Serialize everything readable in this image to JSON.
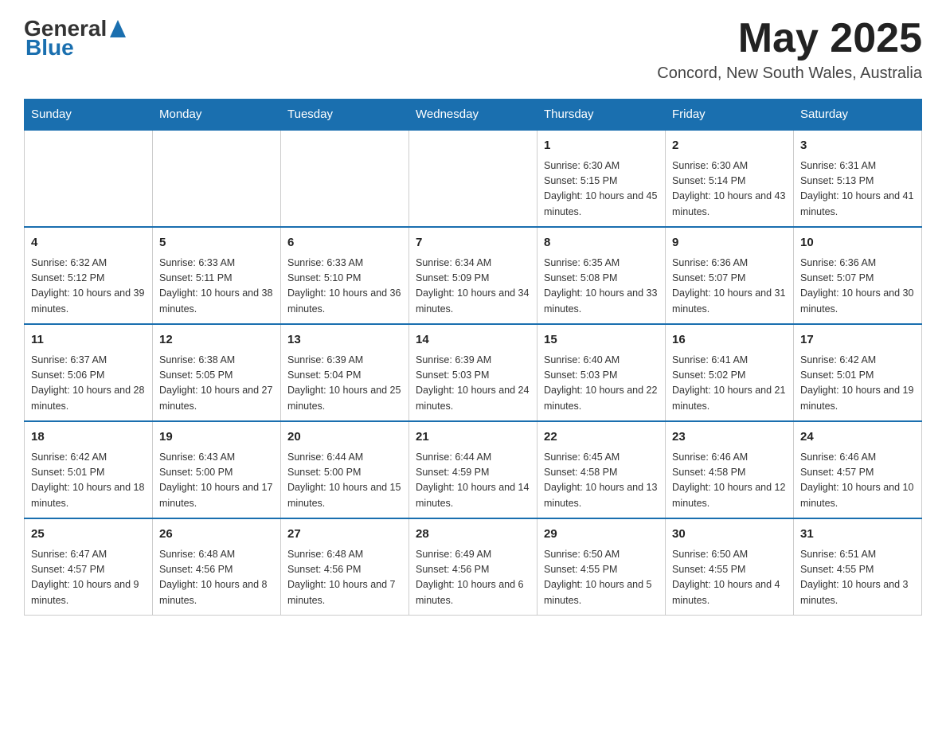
{
  "header": {
    "logo_general": "General",
    "logo_blue": "Blue",
    "month_year": "May 2025",
    "location": "Concord, New South Wales, Australia"
  },
  "days_of_week": [
    "Sunday",
    "Monday",
    "Tuesday",
    "Wednesday",
    "Thursday",
    "Friday",
    "Saturday"
  ],
  "weeks": [
    [
      {
        "day": "",
        "info": ""
      },
      {
        "day": "",
        "info": ""
      },
      {
        "day": "",
        "info": ""
      },
      {
        "day": "",
        "info": ""
      },
      {
        "day": "1",
        "info": "Sunrise: 6:30 AM\nSunset: 5:15 PM\nDaylight: 10 hours and 45 minutes."
      },
      {
        "day": "2",
        "info": "Sunrise: 6:30 AM\nSunset: 5:14 PM\nDaylight: 10 hours and 43 minutes."
      },
      {
        "day": "3",
        "info": "Sunrise: 6:31 AM\nSunset: 5:13 PM\nDaylight: 10 hours and 41 minutes."
      }
    ],
    [
      {
        "day": "4",
        "info": "Sunrise: 6:32 AM\nSunset: 5:12 PM\nDaylight: 10 hours and 39 minutes."
      },
      {
        "day": "5",
        "info": "Sunrise: 6:33 AM\nSunset: 5:11 PM\nDaylight: 10 hours and 38 minutes."
      },
      {
        "day": "6",
        "info": "Sunrise: 6:33 AM\nSunset: 5:10 PM\nDaylight: 10 hours and 36 minutes."
      },
      {
        "day": "7",
        "info": "Sunrise: 6:34 AM\nSunset: 5:09 PM\nDaylight: 10 hours and 34 minutes."
      },
      {
        "day": "8",
        "info": "Sunrise: 6:35 AM\nSunset: 5:08 PM\nDaylight: 10 hours and 33 minutes."
      },
      {
        "day": "9",
        "info": "Sunrise: 6:36 AM\nSunset: 5:07 PM\nDaylight: 10 hours and 31 minutes."
      },
      {
        "day": "10",
        "info": "Sunrise: 6:36 AM\nSunset: 5:07 PM\nDaylight: 10 hours and 30 minutes."
      }
    ],
    [
      {
        "day": "11",
        "info": "Sunrise: 6:37 AM\nSunset: 5:06 PM\nDaylight: 10 hours and 28 minutes."
      },
      {
        "day": "12",
        "info": "Sunrise: 6:38 AM\nSunset: 5:05 PM\nDaylight: 10 hours and 27 minutes."
      },
      {
        "day": "13",
        "info": "Sunrise: 6:39 AM\nSunset: 5:04 PM\nDaylight: 10 hours and 25 minutes."
      },
      {
        "day": "14",
        "info": "Sunrise: 6:39 AM\nSunset: 5:03 PM\nDaylight: 10 hours and 24 minutes."
      },
      {
        "day": "15",
        "info": "Sunrise: 6:40 AM\nSunset: 5:03 PM\nDaylight: 10 hours and 22 minutes."
      },
      {
        "day": "16",
        "info": "Sunrise: 6:41 AM\nSunset: 5:02 PM\nDaylight: 10 hours and 21 minutes."
      },
      {
        "day": "17",
        "info": "Sunrise: 6:42 AM\nSunset: 5:01 PM\nDaylight: 10 hours and 19 minutes."
      }
    ],
    [
      {
        "day": "18",
        "info": "Sunrise: 6:42 AM\nSunset: 5:01 PM\nDaylight: 10 hours and 18 minutes."
      },
      {
        "day": "19",
        "info": "Sunrise: 6:43 AM\nSunset: 5:00 PM\nDaylight: 10 hours and 17 minutes."
      },
      {
        "day": "20",
        "info": "Sunrise: 6:44 AM\nSunset: 5:00 PM\nDaylight: 10 hours and 15 minutes."
      },
      {
        "day": "21",
        "info": "Sunrise: 6:44 AM\nSunset: 4:59 PM\nDaylight: 10 hours and 14 minutes."
      },
      {
        "day": "22",
        "info": "Sunrise: 6:45 AM\nSunset: 4:58 PM\nDaylight: 10 hours and 13 minutes."
      },
      {
        "day": "23",
        "info": "Sunrise: 6:46 AM\nSunset: 4:58 PM\nDaylight: 10 hours and 12 minutes."
      },
      {
        "day": "24",
        "info": "Sunrise: 6:46 AM\nSunset: 4:57 PM\nDaylight: 10 hours and 10 minutes."
      }
    ],
    [
      {
        "day": "25",
        "info": "Sunrise: 6:47 AM\nSunset: 4:57 PM\nDaylight: 10 hours and 9 minutes."
      },
      {
        "day": "26",
        "info": "Sunrise: 6:48 AM\nSunset: 4:56 PM\nDaylight: 10 hours and 8 minutes."
      },
      {
        "day": "27",
        "info": "Sunrise: 6:48 AM\nSunset: 4:56 PM\nDaylight: 10 hours and 7 minutes."
      },
      {
        "day": "28",
        "info": "Sunrise: 6:49 AM\nSunset: 4:56 PM\nDaylight: 10 hours and 6 minutes."
      },
      {
        "day": "29",
        "info": "Sunrise: 6:50 AM\nSunset: 4:55 PM\nDaylight: 10 hours and 5 minutes."
      },
      {
        "day": "30",
        "info": "Sunrise: 6:50 AM\nSunset: 4:55 PM\nDaylight: 10 hours and 4 minutes."
      },
      {
        "day": "31",
        "info": "Sunrise: 6:51 AM\nSunset: 4:55 PM\nDaylight: 10 hours and 3 minutes."
      }
    ]
  ]
}
